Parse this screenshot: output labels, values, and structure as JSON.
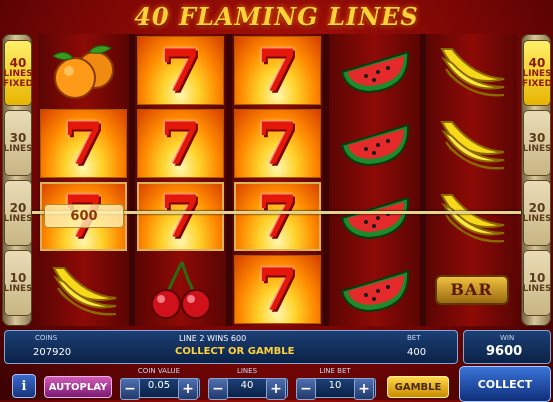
{
  "title": "40 FLAMING LINES",
  "line_indicators": [
    {
      "num": "40",
      "text": "LINES FIXED",
      "active": true
    },
    {
      "num": "30",
      "text": "LINES",
      "active": false
    },
    {
      "num": "20",
      "text": "LINES",
      "active": false
    },
    {
      "num": "10",
      "text": "LINES",
      "active": false
    }
  ],
  "reels": [
    [
      "oranges",
      "seven",
      "seven",
      "bananas"
    ],
    [
      "seven",
      "seven",
      "seven",
      "cherries"
    ],
    [
      "seven",
      "seven",
      "seven",
      "seven"
    ],
    [
      "watermelon",
      "watermelon",
      "watermelon",
      "watermelon"
    ],
    [
      "bananas",
      "bananas",
      "bananas",
      "bar"
    ]
  ],
  "win_amount": "600",
  "info": {
    "coins_label": "COINS",
    "coins_value": "207920",
    "line_win_text": "LINE 2 WINS 600",
    "status_text": "COLLECT OR GAMBLE",
    "bet_label": "BET",
    "bet_value": "400",
    "win_label": "WIN",
    "win_value": "9600"
  },
  "controls": {
    "info_label": "i",
    "autoplay_label": "AUTOPLAY",
    "coin_value_label": "COIN VALUE",
    "coin_value": "0.05",
    "lines_label": "LINES",
    "lines_value": "40",
    "line_bet_label": "LINE BET",
    "line_bet_value": "10",
    "gamble_label": "GAMBLE",
    "collect_label": "COLLECT",
    "minus": "−",
    "plus": "+"
  },
  "symbol_text": {
    "seven": "7",
    "bar": "BAR"
  }
}
